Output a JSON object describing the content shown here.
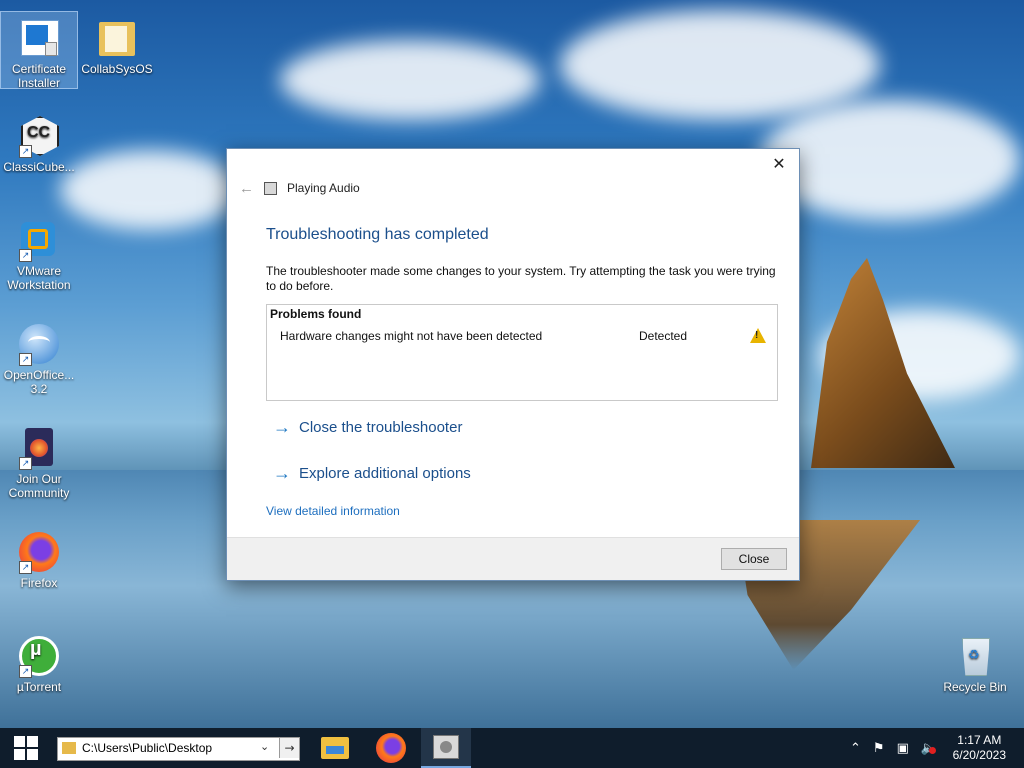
{
  "desktop": {
    "icons": [
      {
        "label": "Certificate Installer",
        "icon": "certificate-installer-icon"
      },
      {
        "label": "CollabSysOS",
        "icon": "folder-icon"
      },
      {
        "label": "ClassiCube...",
        "icon": "classicube-icon"
      },
      {
        "label": "VMware Workstation",
        "icon": "vmware-icon"
      },
      {
        "label": "OpenOffice... 3.2",
        "icon": "openoffice-icon"
      },
      {
        "label": "Join Our Community",
        "icon": "community-icon"
      },
      {
        "label": "Firefox",
        "icon": "firefox-icon"
      },
      {
        "label": "µTorrent",
        "icon": "utorrent-icon"
      },
      {
        "label": "Recycle Bin",
        "icon": "recycle-bin-icon"
      }
    ]
  },
  "dialog": {
    "header": "Playing Audio",
    "title": "Troubleshooting has completed",
    "description": "The troubleshooter made some changes to your system. Try attempting the task you were trying to do before.",
    "problems_header": "Problems found",
    "problems": [
      {
        "name": "Hardware changes might not have been detected",
        "status": "Detected",
        "icon": "warning-icon"
      }
    ],
    "links": {
      "close_troubleshooter": "Close the troubleshooter",
      "explore_options": "Explore additional options",
      "view_details": "View detailed information"
    },
    "close_button": "Close"
  },
  "taskbar": {
    "address": "C:\\Users\\Public\\Desktop",
    "apps": [
      "file-explorer-icon",
      "firefox-icon",
      "troubleshooter-icon"
    ],
    "time": "1:17 AM",
    "date": "6/20/2023"
  }
}
